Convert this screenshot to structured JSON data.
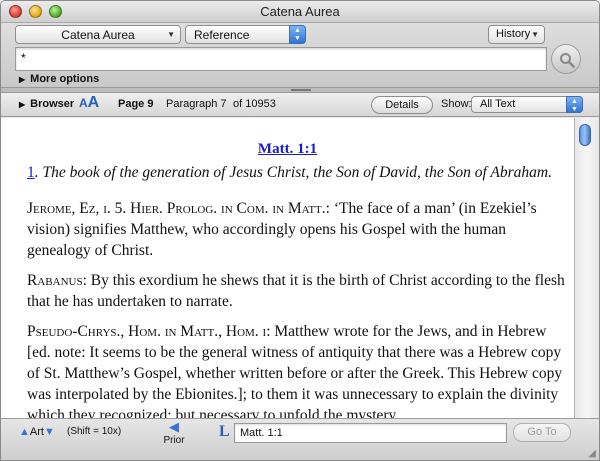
{
  "window": {
    "title": "Catena Aurea"
  },
  "toolbar": {
    "book_popup": "Catena Aurea",
    "search_type_popup": "Reference",
    "history_label": "History",
    "search_value": "*",
    "more_options_label": "More options"
  },
  "browser_bar": {
    "browser_label": "Browser",
    "font_size_small": "A",
    "font_size_big": "A",
    "page": "Page 9",
    "paragraph": "Paragraph 7",
    "of_total": "of 10953",
    "details_label": "Details",
    "show_label": "Show:",
    "show_value": "All Text"
  },
  "content": {
    "heading": "Matt. 1:1",
    "verse_number": "1",
    "verse_text": ". The book of the generation of Jesus Christ, the Son of David, the Son of Abraham.",
    "p1_source": "Jerome, Ez, i. 5. Hier. Prolog. in Com. in Matt.",
    "p1_text": ": ‘The face of a man’ (in Ezekiel’s vision) signifies Matthew, who accordingly opens his Gospel with the human genealogy of Christ.",
    "p2_source": "Rabanus",
    "p2_text": ": By this exordium he shews that it is the birth of Christ according to the flesh that he has undertaken to narrate.",
    "p3_source": "Pseudo-Chrys., Hom. in Matt., Hom. i",
    "p3_text": ": Matthew wrote for the Jews, and in Hebrew [ed. note: It seems to be the general witness of antiquity that there was a Hebrew copy of St. Matthew’s Gospel, whether written before or after the Greek. This Hebrew copy was interpolated by the Ebionites.]; to them it was unnecessary to explain the divinity which they recognized; but necessary to unfold the mystery"
  },
  "bottom_bar": {
    "art_label": "Art",
    "shift_hint": "(Shift = 10x)",
    "prior_label": "Prior",
    "lookup_icon_letter": "L",
    "lookup_value": "Matt. 1:1",
    "goto_label": "Go To"
  },
  "colors": {
    "link_blue": "#1a1ac8",
    "accent_blue": "#2f74d6"
  }
}
